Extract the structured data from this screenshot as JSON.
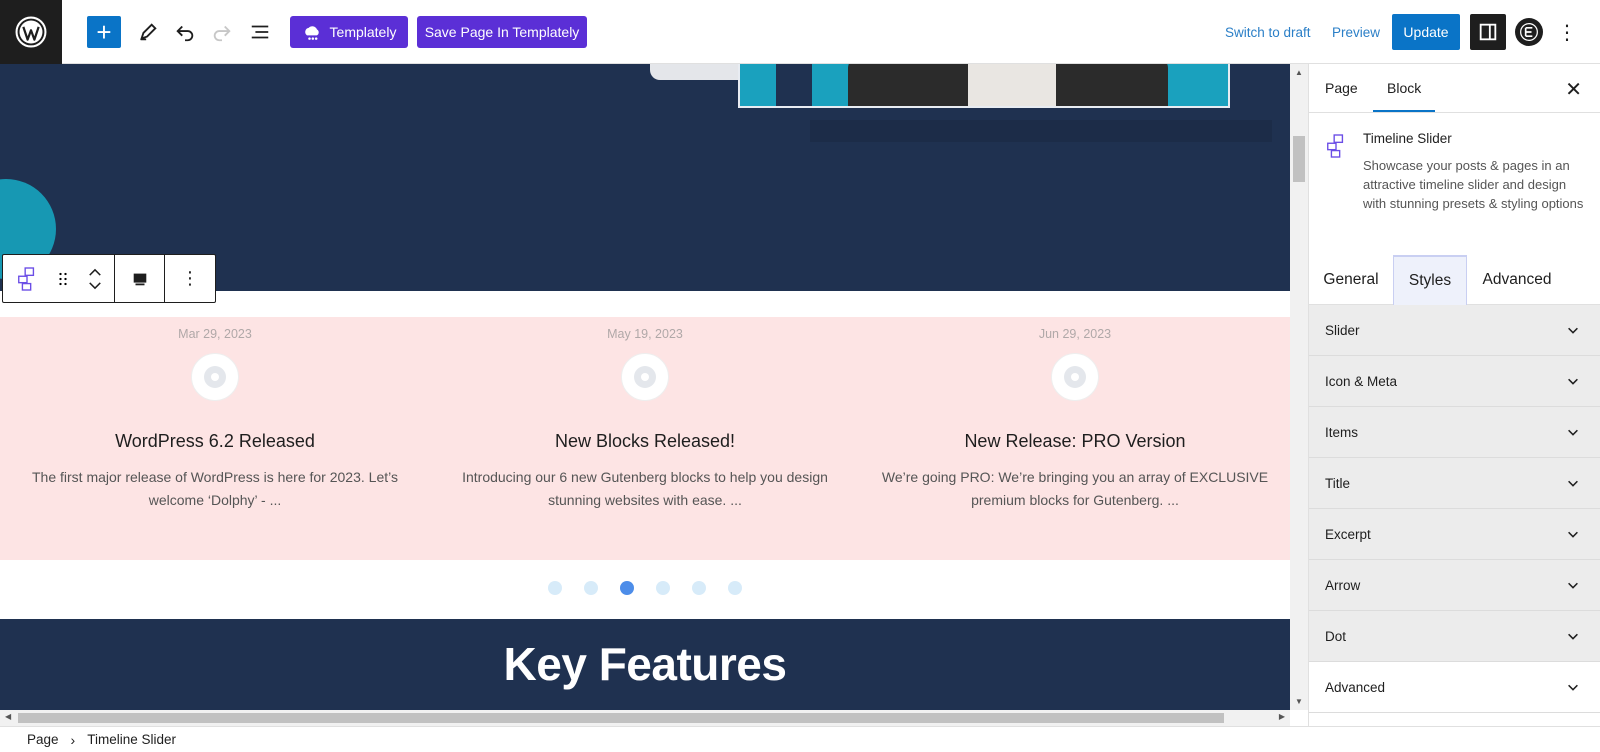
{
  "toolbar": {
    "templately_label": "Templately",
    "save_templately_label": "Save Page In Templately",
    "switch_draft_label": "Switch to draft",
    "preview_label": "Preview",
    "update_label": "Update"
  },
  "timeline": {
    "items": [
      {
        "date": "Mar 29, 2023",
        "title": "WordPress 6.2 Released",
        "excerpt": "The first major release of WordPress is here for 2023. Let’s welcome ‘Dolphy’ - ..."
      },
      {
        "date": "May 19, 2023",
        "title": "New Blocks Released!",
        "excerpt": "Introducing our 6 new Gutenberg blocks to help you design stunning websites with ease. ..."
      },
      {
        "date": "Jun 29, 2023",
        "title": "New Release: PRO Version",
        "excerpt": "We’re going PRO: We’re bringing you an array of EXCLUSIVE premium blocks for Gutenberg. ..."
      }
    ],
    "pager": {
      "count": 6,
      "active_index": 2
    }
  },
  "features": {
    "heading": "Key Features"
  },
  "sidebar": {
    "tabs": [
      "Page",
      "Block"
    ],
    "active_tab": "Block",
    "block_name": "Timeline Slider",
    "block_description": "Showcase your posts & pages in an attractive timeline slider and design with stunning presets & styling options",
    "style_tabs": [
      "General",
      "Styles",
      "Advanced"
    ],
    "active_style_tab": "Styles",
    "panels": [
      "Slider",
      "Icon & Meta",
      "Items",
      "Title",
      "Excerpt",
      "Arrow",
      "Dot",
      "Advanced"
    ]
  },
  "breadcrumb": {
    "items": [
      "Page",
      "Timeline Slider"
    ]
  },
  "colors": {
    "wp_blue": "#0a74c7",
    "templately_purple": "#5b2fd6",
    "hero_navy": "#1f3150",
    "timeline_bg": "#fde4e4",
    "pager_active": "#4d8de9"
  }
}
